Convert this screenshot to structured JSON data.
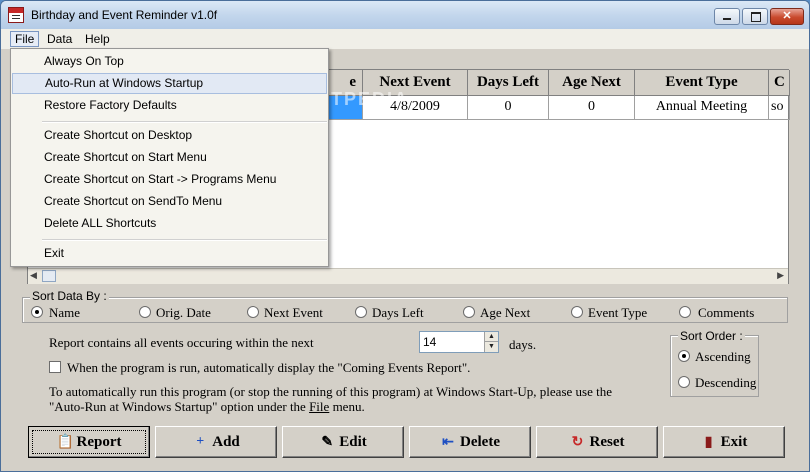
{
  "window": {
    "title": "Birthday and Event Reminder v1.0f"
  },
  "menu": {
    "file": "File",
    "data": "Data",
    "help": "Help",
    "file_items": {
      "always_on_top": "Always On Top",
      "auto_run": "Auto-Run at Windows Startup",
      "restore": "Restore Factory Defaults",
      "shortcut_desktop": "Create Shortcut on Desktop",
      "shortcut_start": "Create Shortcut on Start Menu",
      "shortcut_programs": "Create Shortcut on Start -> Programs Menu",
      "shortcut_sendto": "Create Shortcut on SendTo Menu",
      "delete_shortcuts": "Delete ALL Shortcuts",
      "exit": "Exit"
    }
  },
  "grid": {
    "headers": {
      "col0": "e",
      "next_event": "Next Event",
      "days_left": "Days Left",
      "age_next": "Age Next",
      "event_type": "Event Type",
      "comments": "C"
    },
    "row1": {
      "next_event": "4/8/2009",
      "days_left": "0",
      "age_next": "0",
      "event_type": "Annual Meeting",
      "comments": "so"
    }
  },
  "watermark": "SOFTPEDIA",
  "sort": {
    "label": "Sort Data By :",
    "options": {
      "name": "Name",
      "orig_date": "Orig. Date",
      "next_event": "Next Event",
      "days_left": "Days Left",
      "age_next": "Age Next",
      "event_type": "Event Type",
      "comments": "Comments"
    },
    "selected": "Name"
  },
  "report": {
    "within_text": "Report contains all events occuring within the next",
    "days_value": "14",
    "days_suffix": "days.",
    "auto_display": "When the program is run, automatically display the \"Coming Events Report\".",
    "info_line1": "To automatically run this program (or stop the running of this program) at Windows Start-Up, please use the",
    "info_line2_a": "\"Auto-Run at Windows Startup\" option under the ",
    "info_line2_file": "File",
    "info_line2_b": " menu."
  },
  "sort_order": {
    "label": "Sort Order :",
    "ascending": "Ascending",
    "descending": "Descending",
    "selected": "Ascending"
  },
  "buttons": {
    "report": "Report",
    "add": "Add",
    "edit": "Edit",
    "delete": "Delete",
    "reset": "Reset",
    "exit": "Exit"
  },
  "colors": {
    "selection": "#3399ff",
    "face": "#d4d0c8",
    "reset_icon": "#c62828",
    "add_icon": "#1e4fc2"
  }
}
